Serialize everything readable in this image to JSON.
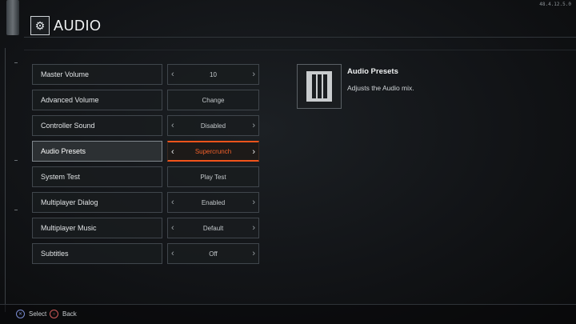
{
  "version": "48.4.12.5.0",
  "header": {
    "title": "AUDIO",
    "icon": "gear-icon"
  },
  "settings": [
    {
      "label": "Master Volume",
      "value": "10",
      "arrows": true
    },
    {
      "label": "Advanced Volume",
      "value": "Change",
      "arrows": false
    },
    {
      "label": "Controller Sound",
      "value": "Disabled",
      "arrows": true
    },
    {
      "label": "Audio Presets",
      "value": "Supercrunch",
      "arrows": true,
      "focused": true
    },
    {
      "label": "System Test",
      "value": "Play Test",
      "arrows": false
    },
    {
      "label": "Multiplayer Dialog",
      "value": "Enabled",
      "arrows": true
    },
    {
      "label": "Multiplayer Music",
      "value": "Default",
      "arrows": true
    },
    {
      "label": "Subtitles",
      "value": "Off",
      "arrows": true
    }
  ],
  "info": {
    "title": "Audio Presets",
    "description": "Adjusts the Audio mix."
  },
  "footer": {
    "select_label": "Select",
    "back_label": "Back"
  },
  "colors": {
    "accent": "#f2541b",
    "background": "#15181b"
  }
}
